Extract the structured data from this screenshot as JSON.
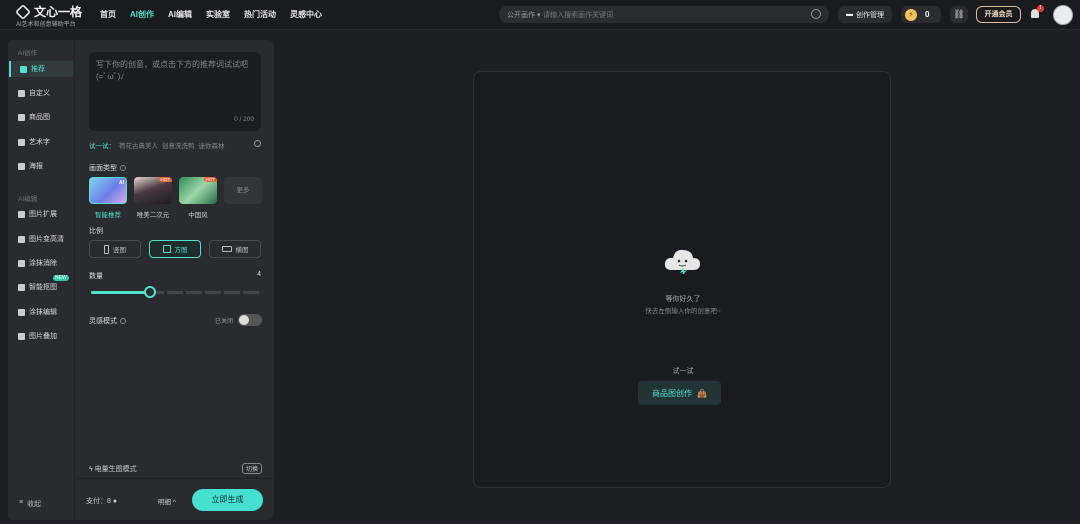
{
  "brand": {
    "name": "文心一格",
    "tagline": "AI艺术和创意辅助平台"
  },
  "nav": [
    "首页",
    "AI创作",
    "AI编辑",
    "实验室",
    "热门活动",
    "灵感中心"
  ],
  "nav_active": "AI创作",
  "search": {
    "scope": "公开画作",
    "placeholder": "请输入搜索画作关键词"
  },
  "header": {
    "manage_label": "创作管理",
    "coins": "0",
    "vip_label": "开通会员",
    "notif_count": "1"
  },
  "sidebar": {
    "section1": "AI创作",
    "items1": [
      {
        "label": "推荐",
        "icon": "pencil-icon"
      },
      {
        "label": "自定义",
        "icon": "cube-icon"
      },
      {
        "label": "商品图",
        "icon": "image-icon"
      },
      {
        "label": "艺术字",
        "icon": "text-icon"
      },
      {
        "label": "海报",
        "icon": "poster-icon"
      }
    ],
    "section2": "AI编辑",
    "items2": [
      {
        "label": "图片扩展",
        "icon": "expand-icon"
      },
      {
        "label": "图片变高清",
        "icon": "hd-icon"
      },
      {
        "label": "涂抹消除",
        "icon": "eraser-icon"
      },
      {
        "label": "智能抠图",
        "icon": "cutout-icon",
        "badge": "NEW"
      },
      {
        "label": "涂抹编辑",
        "icon": "brush-icon"
      },
      {
        "label": "图片叠加",
        "icon": "layers-icon"
      }
    ],
    "collapse_label": "收起"
  },
  "prompt": {
    "placeholder": "写下你的创意，或点击下方的推荐词试试吧(=ﾟωﾟ)ﾉ",
    "count": "0 / 200"
  },
  "try": {
    "label": "试一试：",
    "items": [
      "荷花古典美人",
      "创意洗洗鸭",
      "迷你森林"
    ]
  },
  "style": {
    "title": "画面类型",
    "items": [
      {
        "label": "智能推荐",
        "tag": "AI"
      },
      {
        "label": "唯美二次元",
        "tag": "HOT"
      },
      {
        "label": "中国风",
        "tag": "HOT"
      }
    ],
    "more": "更多"
  },
  "ratio": {
    "title": "比例",
    "items": [
      "竖图",
      "方图",
      "横图"
    ],
    "active": "方图"
  },
  "count": {
    "title": "数量",
    "value": "4",
    "fraction": 0.35
  },
  "inspire": {
    "title": "灵感模式",
    "state": "已关闭"
  },
  "mode": {
    "label": "电量生图模式",
    "switch": "切换"
  },
  "footer": {
    "cost_label": "支付：",
    "cost_value": "8",
    "detail": "明细",
    "generate": "立即生成"
  },
  "canvas": {
    "empty_title": "等你好久了",
    "empty_sub": "快去左侧输入你的创意吧~",
    "try_label": "试一试",
    "product_button": "商品图创作"
  },
  "colors": {
    "accent": "#4fe0d0",
    "background": "#1e1f22",
    "panel": "#2a2b2f"
  }
}
